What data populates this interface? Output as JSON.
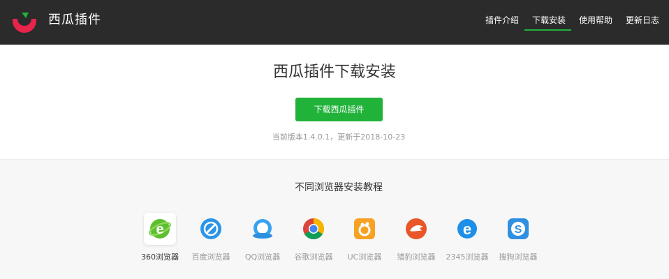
{
  "header": {
    "brand": "西瓜插件",
    "nav": [
      {
        "label": "插件介绍",
        "active": false
      },
      {
        "label": "下载安装",
        "active": true
      },
      {
        "label": "使用帮助",
        "active": false
      },
      {
        "label": "更新日志",
        "active": false
      }
    ],
    "colors": {
      "background": "#2b2b2b",
      "accent": "#21b23a"
    }
  },
  "hero": {
    "title": "西瓜插件下载安装",
    "download_button": "下载西瓜插件",
    "version_text": "当前版本1.4.0.1，更新于2018-10-23"
  },
  "tutorial": {
    "title": "不同浏览器安装教程",
    "browsers": [
      {
        "label": "360浏览器",
        "icon": "360-browser-icon",
        "active": true
      },
      {
        "label": "百度浏览器",
        "icon": "baidu-browser-icon",
        "active": false
      },
      {
        "label": "QQ浏览器",
        "icon": "qq-browser-icon",
        "active": false
      },
      {
        "label": "谷歌浏览器",
        "icon": "chrome-icon",
        "active": false
      },
      {
        "label": "UC浏览器",
        "icon": "uc-browser-icon",
        "active": false
      },
      {
        "label": "猎豹浏览器",
        "icon": "liebao-browser-icon",
        "active": false
      },
      {
        "label": "2345浏览器",
        "icon": "2345-browser-icon",
        "active": false
      },
      {
        "label": "搜狗浏览器",
        "icon": "sogou-browser-icon",
        "active": false
      }
    ]
  }
}
